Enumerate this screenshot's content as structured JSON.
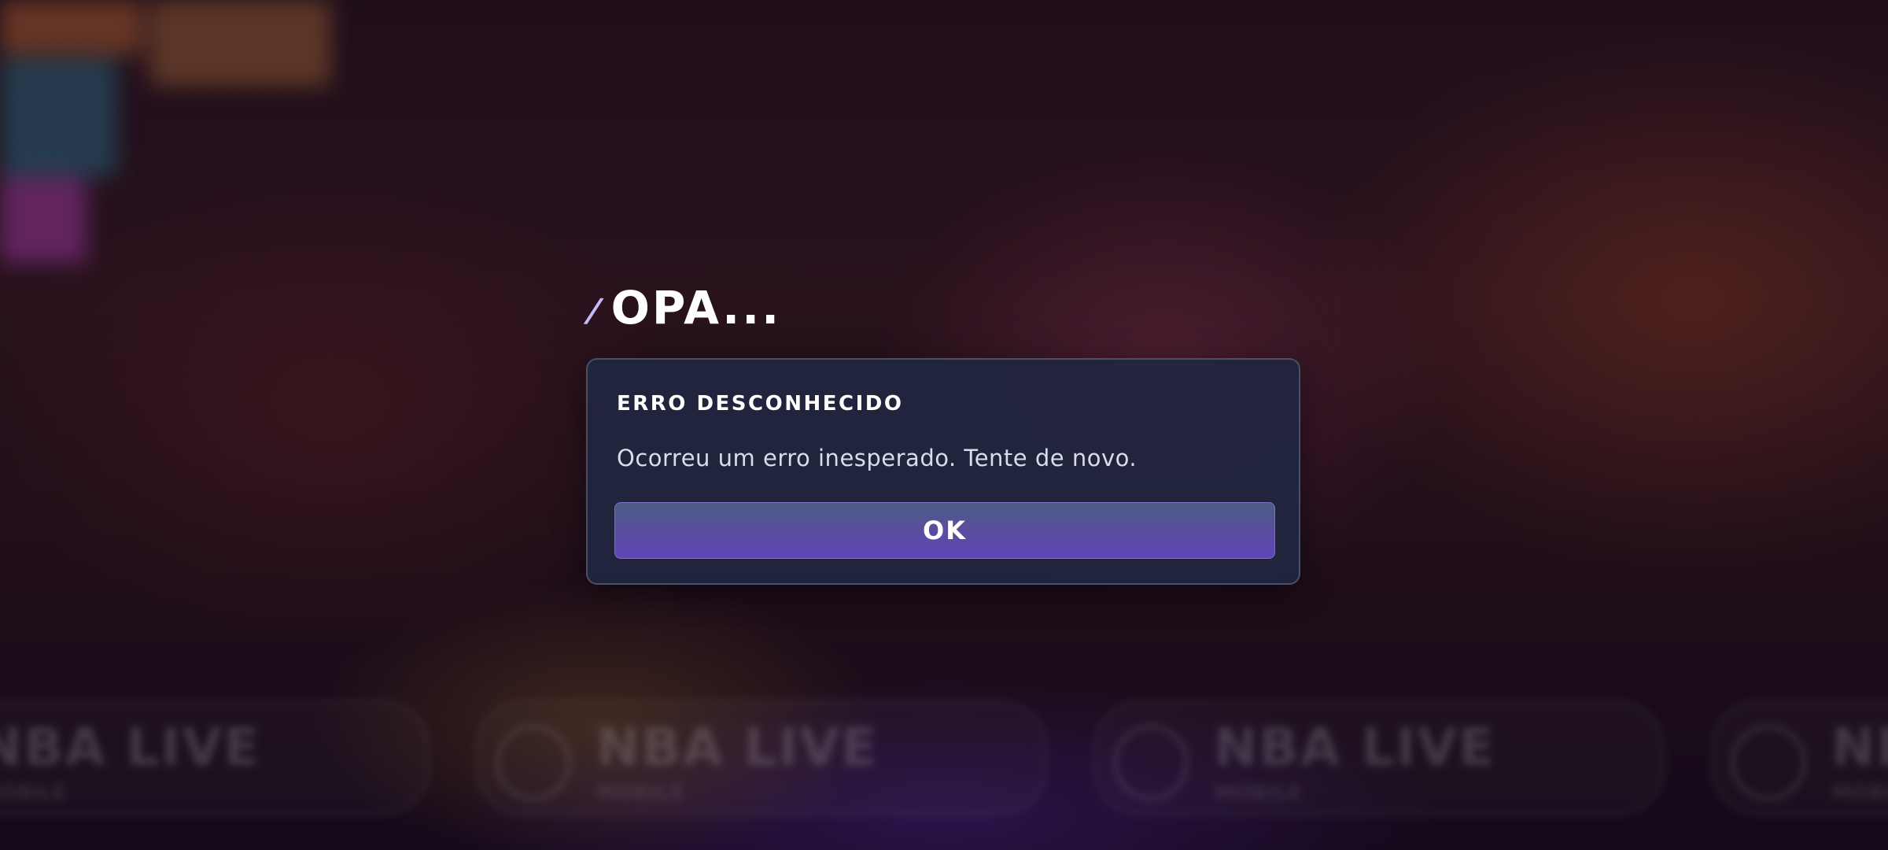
{
  "dialog": {
    "title_prefix": "/",
    "title": "OPA...",
    "heading": "ERRO DESCONHECIDO",
    "message": "Ocorreu um erro inesperado. Tente de novo.",
    "ok_label": "OK"
  },
  "background": {
    "banner_text": "NBA LIVE",
    "banner_subtext": "MOBILE",
    "banner_count": 4
  },
  "colors": {
    "dialog_bg": "#202640",
    "button_top": "#4e5c84",
    "button_bottom": "#6045b4",
    "title_accent": "#c7b8ff",
    "text_primary": "#ffffff"
  }
}
